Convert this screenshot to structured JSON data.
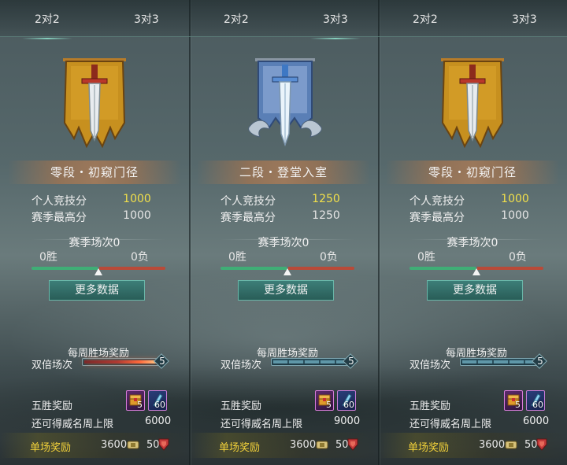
{
  "tabs": {
    "two_v_two": "2对2",
    "three_v_three": "3对3"
  },
  "columns": [
    {
      "active_tab": "2v2",
      "emblem": "gold-banner-sword-icon",
      "rank_title": "零段・初窥门径",
      "personal_label": "个人竞技分",
      "personal_value": "1000",
      "season_high_label": "赛季最高分",
      "season_high_value": "1000",
      "season_matches": "赛季场次0",
      "wins": "0胜",
      "losses": "0负",
      "more_data": "更多数据",
      "weekly_title": "每周胜场奖励",
      "double_label": "双倍场次",
      "double_count": "5",
      "double_style": "hot",
      "five_win_label": "五胜奖励",
      "chest_count": "5",
      "fragment_count": "60",
      "limit_label": "还可得威名周上限",
      "limit_value": "6000",
      "single_label": "单场奖励",
      "coin_value": "3600",
      "honor_value": "50"
    },
    {
      "active_tab": "3v3",
      "emblem": "silver-banner-sword-icon",
      "rank_title": "二段・登堂入室",
      "personal_label": "个人竞技分",
      "personal_value": "1250",
      "season_high_label": "赛季最高分",
      "season_high_value": "1250",
      "season_matches": "赛季场次0",
      "wins": "0胜",
      "losses": "0负",
      "more_data": "更多数据",
      "weekly_title": "每周胜场奖励",
      "double_label": "双倍场次",
      "double_count": "5",
      "double_style": "cool",
      "five_win_label": "五胜奖励",
      "chest_count": "5",
      "fragment_count": "60",
      "limit_label": "还可得威名周上限",
      "limit_value": "9000",
      "single_label": "单场奖励",
      "coin_value": "3600",
      "honor_value": "50"
    },
    {
      "active_tab": "none",
      "emblem": "gold-banner-sword-icon",
      "rank_title": "零段・初窥门径",
      "personal_label": "个人竞技分",
      "personal_value": "1000",
      "season_high_label": "赛季最高分",
      "season_high_value": "1000",
      "season_matches": "赛季场次0",
      "wins": "0胜",
      "losses": "0负",
      "more_data": "更多数据",
      "weekly_title": "每周胜场奖励",
      "double_label": "双倍场次",
      "double_count": "5",
      "double_style": "cool",
      "five_win_label": "五胜奖励",
      "chest_count": "5",
      "fragment_count": "60",
      "limit_label": "还可得威名周上限",
      "limit_value": "6000",
      "single_label": "单场奖励",
      "coin_value": "3600",
      "honor_value": "50"
    }
  ],
  "colors": {
    "highlight_score": "#f2e04a",
    "single_label": "#f3d23a",
    "win_bar": "#3fae76",
    "loss_bar": "#b94a38",
    "button": "#2f6d67"
  }
}
